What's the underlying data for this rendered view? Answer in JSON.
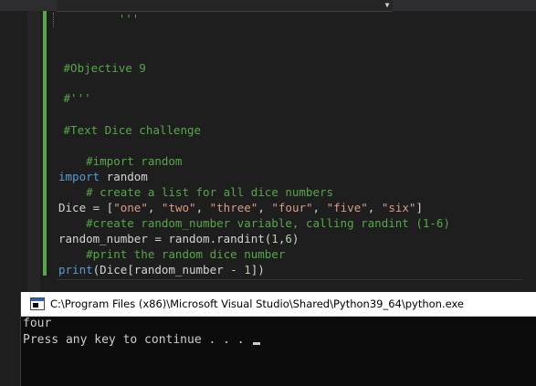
{
  "editor": {
    "lines": [
      "         '''",
      " #Objective 9",
      " #'''",
      " #Text Dice challenge",
      "    #import random",
      "import random",
      "    # create a list for all dice numbers",
      "Dice = [\"one\", \"two\", \"three\", \"four\", \"five\", \"six\"]",
      "    #create random_number variable, calling randint (1-6)",
      "random_number = random.randint(1,6)",
      "    #print the random dice number",
      "print(Dice[random_number - 1])"
    ]
  },
  "console": {
    "title": "C:\\Program Files (x86)\\Microsoft Visual Studio\\Shared\\Python39_64\\python.exe",
    "output_lines": [
      "four",
      "Press any key to continue . . . "
    ]
  },
  "colors": {
    "comment": "#57a64a",
    "keyword": "#569cd6",
    "string": "#d69d85",
    "number": "#b5cea8",
    "editor_bg": "#1e1e1e",
    "console_bg": "#0c0c0c"
  },
  "icons": [
    "dropdown-arrow-icon",
    "console-app-icon",
    "text-cursor-icon"
  ]
}
